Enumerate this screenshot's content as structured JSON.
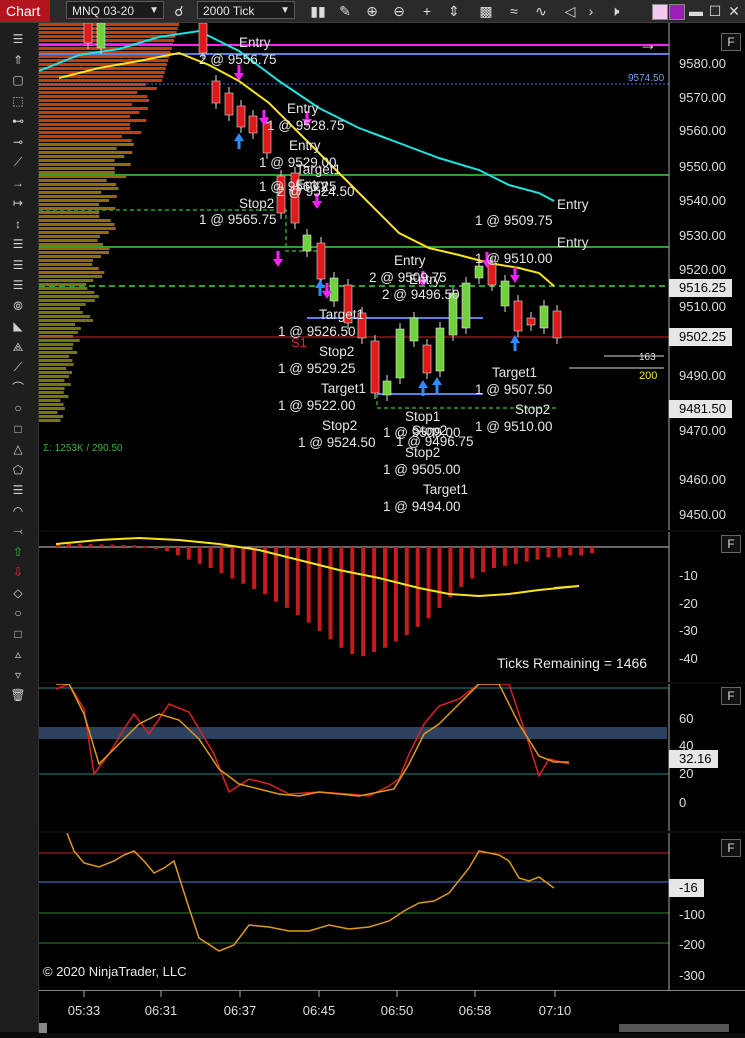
{
  "toolbar": {
    "chart_label": "Chart",
    "instrument": "MNQ 03-20",
    "interval": "2000 Tick",
    "icons": [
      "search-icon",
      "bar-style-icon",
      "draw-icon",
      "zoom-in-icon",
      "zoom-out-icon",
      "crosshair-icon",
      "up-down-icon",
      "strategy-icon",
      "indicator-icon",
      "properties-icon",
      "minimize-icon",
      "maximize-icon",
      "close-icon"
    ]
  },
  "left_tools": [
    "bars-icon",
    "arrow-up-icon",
    "box-icon",
    "dash-box-icon",
    "line-icon",
    "line-icon",
    "diag-line-icon",
    "ray-icon",
    "ext-line-icon",
    "vert-line-icon",
    "fib-icon",
    "fib-ext-icon",
    "fib-time-icon",
    "fib-circle-icon",
    "gann-icon",
    "andrew-icon",
    "regression-icon",
    "arc-icon",
    "ellipse-icon",
    "rect-icon",
    "triangle-icon",
    "polygon-icon",
    "ruler-icon",
    "arc2-icon",
    "path-icon",
    "arrow-up-green-icon",
    "arrow-down-red-icon",
    "diamond-icon",
    "circle-icon",
    "square-icon",
    "triangle-up-icon",
    "triangle-down-icon",
    "trash-icon"
  ],
  "main_panel": {
    "price_axis": [
      "9580.00",
      "9570.00",
      "9560.00",
      "9550.00",
      "9540.00",
      "9530.00",
      "9520.00",
      "9510.00",
      "9490.00",
      "9470.00",
      "9460.00",
      "9450.00"
    ],
    "tags": {
      "last": "9516.25",
      "mid": "9502.25",
      "low": "9481.50",
      "top_line": "9574.50"
    },
    "volume_profile_label": "Σ: 1253K / 290.50",
    "depth_labels": [
      "163",
      "200"
    ],
    "s1_label": "S1",
    "labels": [
      {
        "t": "Entry"
      },
      {
        "t": "2 @ 9556.75"
      },
      {
        "t": "Entry"
      },
      {
        "t": "1 @ 9528.75"
      },
      {
        "t": "Entry"
      },
      {
        "t": "1 @ 9529.00"
      },
      {
        "t": "Target1"
      },
      {
        "t": "1 @ 9563.25"
      },
      {
        "t": "Entry"
      },
      {
        "t": "2 @ 9524.50"
      },
      {
        "t": "Stop2"
      },
      {
        "t": "1 @ 9565.75"
      },
      {
        "t": "Entry"
      },
      {
        "t": "1 @ 9509.75"
      },
      {
        "t": "Entry"
      },
      {
        "t": "1 @ 9510.00"
      },
      {
        "t": "Entry"
      },
      {
        "t": "2 @ 9509.75"
      },
      {
        "t": "Entry"
      },
      {
        "t": "2 @ 9496.50"
      },
      {
        "t": "Target1"
      },
      {
        "t": "1 @ 9526.50"
      },
      {
        "t": "Stop2"
      },
      {
        "t": "1 @ 9529.25"
      },
      {
        "t": "Target1"
      },
      {
        "t": "1 @ 9522.00"
      },
      {
        "t": "Target1"
      },
      {
        "t": "1 @ 9507.50"
      },
      {
        "t": "Stop1"
      },
      {
        "t": "1 @ 9509.00"
      },
      {
        "t": "Stop2"
      },
      {
        "t": "1 @ 9496.75"
      },
      {
        "t": "Stop2"
      },
      {
        "t": "1 @ 9524.50"
      },
      {
        "t": "Stop2"
      },
      {
        "t": "1 @ 9510.00"
      },
      {
        "t": "Stop2"
      },
      {
        "t": "1 @ 9505.00"
      },
      {
        "t": "Target1"
      },
      {
        "t": "1 @ 9494.00"
      }
    ]
  },
  "osc_panel": {
    "axis": [
      "-10",
      "-20",
      "-30",
      "-40"
    ],
    "status": "Ticks Remaining = 1466"
  },
  "stoch_panel": {
    "axis": [
      "60",
      "40",
      "20",
      "0"
    ],
    "tag": "32.16"
  },
  "cci_panel": {
    "axis": [
      "-100",
      "-200",
      "-300"
    ],
    "tag": "-16",
    "copyright": "© 2020 NinjaTrader, LLC"
  },
  "time_axis": [
    "05:33",
    "06:31",
    "06:37",
    "06:45",
    "06:50",
    "06:58",
    "07:10"
  ],
  "colors": {
    "accent": "#b4141d",
    "ema_fast": "#f7e51a",
    "ema_slow": "#1ee3e3",
    "magenta": "#ff1fff",
    "blue_line": "#5a82e6",
    "green_line": "#2aa52a"
  }
}
